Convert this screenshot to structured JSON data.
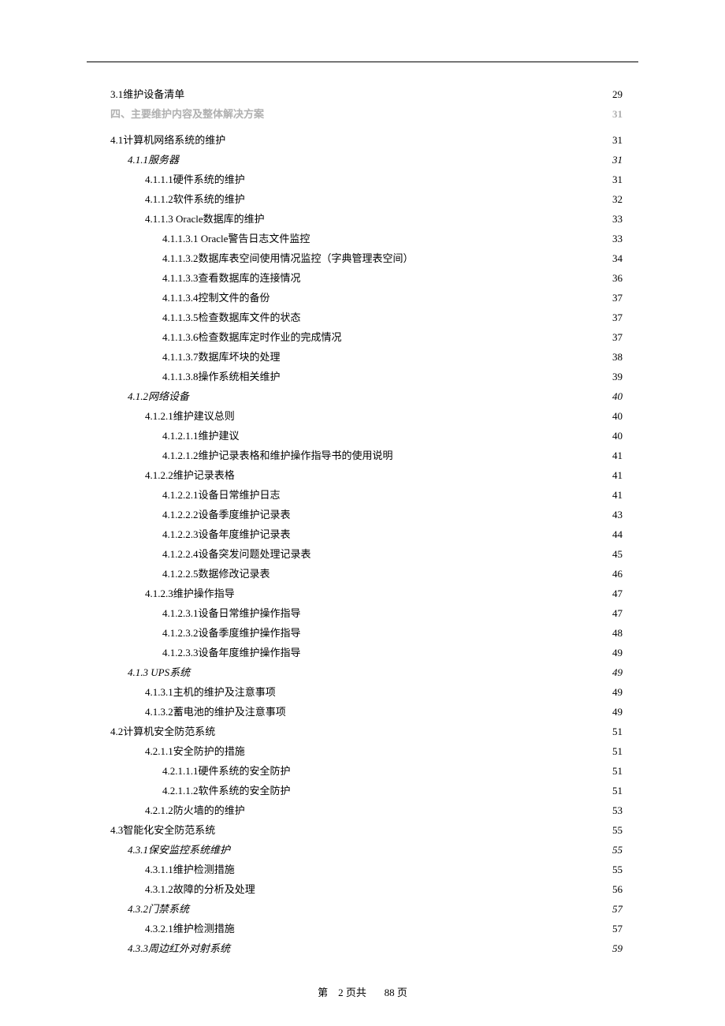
{
  "toc": [
    {
      "level": 1,
      "title": "3.1维护设备清单",
      "page": "29",
      "style": ""
    },
    {
      "level": 0,
      "title": "四、主要维护内容及整体解决方案",
      "page": "31",
      "style": "bold gray spaced-h1"
    },
    {
      "level": 1,
      "title": "4.1计算机网络系统的维护",
      "page": "31",
      "style": ""
    },
    {
      "level": 2,
      "title": "4.1.1服务器",
      "page": "31",
      "style": "italic"
    },
    {
      "level": 3,
      "title": "4.1.1.1硬件系统的维护",
      "page": "31",
      "style": ""
    },
    {
      "level": 3,
      "title": "4.1.1.2软件系统的维护",
      "page": "32",
      "style": ""
    },
    {
      "level": 3,
      "title": "4.1.1.3 Oracle数据库的维护",
      "page": "33",
      "style": ""
    },
    {
      "level": 4,
      "title": "4.1.1.3.1 Oracle警告日志文件监控",
      "page": "33",
      "style": ""
    },
    {
      "level": 4,
      "title": "4.1.1.3.2数据库表空间使用情况监控（字典管理表空间）",
      "page": "34",
      "style": ""
    },
    {
      "level": 4,
      "title": "4.1.1.3.3查看数据库的连接情况",
      "page": "36",
      "style": ""
    },
    {
      "level": 4,
      "title": "4.1.1.3.4控制文件的备份",
      "page": "37",
      "style": ""
    },
    {
      "level": 4,
      "title": "4.1.1.3.5检查数据库文件的状态",
      "page": "37",
      "style": ""
    },
    {
      "level": 4,
      "title": "4.1.1.3.6检查数据库定时作业的完成情况",
      "page": "37",
      "style": ""
    },
    {
      "level": 4,
      "title": "4.1.1.3.7数据库坏块的处理",
      "page": "38",
      "style": ""
    },
    {
      "level": 4,
      "title": "4.1.1.3.8操作系统相关维护",
      "page": "39",
      "style": ""
    },
    {
      "level": 2,
      "title": "4.1.2网络设备",
      "page": "40",
      "style": "italic"
    },
    {
      "level": 3,
      "title": "4.1.2.1维护建议总则",
      "page": "40",
      "style": ""
    },
    {
      "level": 4,
      "title": "4.1.2.1.1维护建议",
      "page": "40",
      "style": ""
    },
    {
      "level": 4,
      "title": "4.1.2.1.2维护记录表格和维护操作指导书的使用说明",
      "page": "41",
      "style": ""
    },
    {
      "level": 3,
      "title": "4.1.2.2维护记录表格",
      "page": "41",
      "style": ""
    },
    {
      "level": 4,
      "title": "4.1.2.2.1设备日常维护日志",
      "page": "41",
      "style": ""
    },
    {
      "level": 4,
      "title": "4.1.2.2.2设备季度维护记录表",
      "page": "43",
      "style": ""
    },
    {
      "level": 4,
      "title": "4.1.2.2.3设备年度维护记录表",
      "page": "44",
      "style": ""
    },
    {
      "level": 4,
      "title": "4.1.2.2.4设备突发问题处理记录表",
      "page": "45",
      "style": ""
    },
    {
      "level": 4,
      "title": "4.1.2.2.5数据修改记录表",
      "page": "46",
      "style": ""
    },
    {
      "level": 3,
      "title": "4.1.2.3维护操作指导",
      "page": "47",
      "style": ""
    },
    {
      "level": 4,
      "title": "4.1.2.3.1设备日常维护操作指导",
      "page": "47",
      "style": ""
    },
    {
      "level": 4,
      "title": "4.1.2.3.2设备季度维护操作指导",
      "page": "48",
      "style": ""
    },
    {
      "level": 4,
      "title": "4.1.2.3.3设备年度维护操作指导",
      "page": "49",
      "style": ""
    },
    {
      "level": 2,
      "title": "4.1.3 UPS系统",
      "page": "49",
      "style": "italic"
    },
    {
      "level": 3,
      "title": "4.1.3.1主机的维护及注意事项",
      "page": "49",
      "style": ""
    },
    {
      "level": 3,
      "title": "4.1.3.2蓄电池的维护及注意事项",
      "page": "49",
      "style": ""
    },
    {
      "level": 1,
      "title": "4.2计算机安全防范系统",
      "page": "51",
      "style": ""
    },
    {
      "level": 3,
      "title": "4.2.1.1安全防护的措施",
      "page": "51",
      "style": ""
    },
    {
      "level": 4,
      "title": "4.2.1.1.1硬件系统的安全防护",
      "page": "51",
      "style": ""
    },
    {
      "level": 4,
      "title": "4.2.1.1.2软件系统的安全防护",
      "page": "51",
      "style": ""
    },
    {
      "level": 3,
      "title": "4.2.1.2防火墙的的维护",
      "page": "53",
      "style": ""
    },
    {
      "level": 1,
      "title": "4.3智能化安全防范系统",
      "page": "55",
      "style": ""
    },
    {
      "level": 2,
      "title": "4.3.1保安监控系统维护",
      "page": "55",
      "style": "italic"
    },
    {
      "level": 3,
      "title": "4.3.1.1维护检测措施",
      "page": "55",
      "style": ""
    },
    {
      "level": 3,
      "title": "4.3.1.2故障的分析及处理",
      "page": "56",
      "style": ""
    },
    {
      "level": 2,
      "title": "4.3.2门禁系统",
      "page": "57",
      "style": "italic"
    },
    {
      "level": 3,
      "title": "4.3.2.1维护检测措施",
      "page": "57",
      "style": ""
    },
    {
      "level": 2,
      "title": "4.3.3周边红外对射系统",
      "page": "59",
      "style": "italic"
    }
  ],
  "footer": {
    "prefix": "第",
    "current": "2",
    "mid": "页共",
    "total": "88",
    "suffix": "页"
  }
}
